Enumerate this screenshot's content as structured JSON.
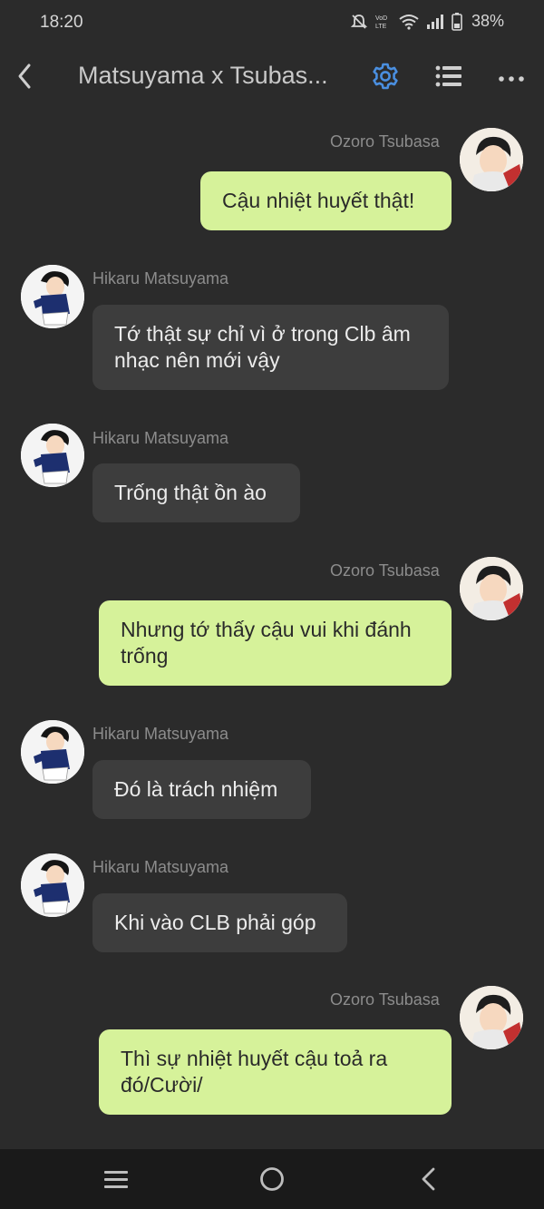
{
  "status_bar": {
    "time": "18:20",
    "battery": "38%"
  },
  "header": {
    "title": "Matsuyama x Tsubas..."
  },
  "messages": [
    {
      "side": "right",
      "sender": "Ozoro Tsubasa",
      "text": "Cậu nhiệt huyết thật!"
    },
    {
      "side": "left",
      "sender": "Hikaru Matsuyama",
      "text": "Tớ thật sự chỉ vì ở trong Clb âm nhạc nên mới vậy"
    },
    {
      "side": "left",
      "sender": "Hikaru Matsuyama",
      "text": "Trống thật ồn ào"
    },
    {
      "side": "right",
      "sender": "Ozoro Tsubasa",
      "text": "Nhưng tớ thấy cậu vui khi đánh trống"
    },
    {
      "side": "left",
      "sender": "Hikaru Matsuyama",
      "text": "Đó là trách nhiệm"
    },
    {
      "side": "left",
      "sender": "Hikaru Matsuyama",
      "text": "Khi vào CLB phải góp"
    },
    {
      "side": "right",
      "sender": "Ozoro Tsubasa",
      "text": "Thì sự nhiệt huyết cậu toả ra đó/Cười/"
    }
  ],
  "colors": {
    "bubble_right": "#d6f29a",
    "bubble_left": "#3d3d3d",
    "accent": "#4a8fe0",
    "background": "#2b2b2b"
  },
  "icons": [
    "back-arrow-icon",
    "settings-gear-icon",
    "list-icon",
    "more-dots-icon",
    "menu-icon",
    "home-circle-icon",
    "back-chevron-icon"
  ]
}
